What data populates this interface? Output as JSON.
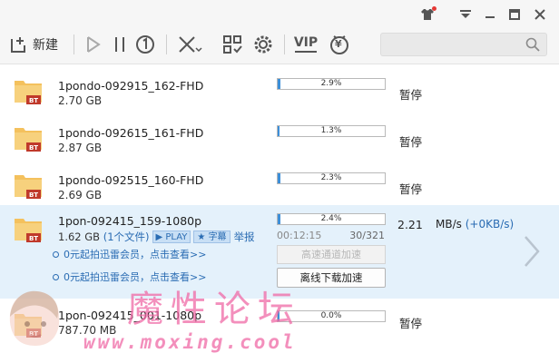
{
  "toolbar": {
    "new_label": "新建",
    "vip_label": "VIP",
    "yen_label": "¥",
    "search_placeholder": ""
  },
  "downloads": [
    {
      "name": "1pondo-092915_162-FHD",
      "size": "2.70 GB",
      "progress": "2.9%",
      "progress_value": 0.029,
      "status": "暂停"
    },
    {
      "name": "1pondo-092615_161-FHD",
      "size": "2.87 GB",
      "progress": "1.3%",
      "progress_value": 0.013,
      "status": "暂停"
    },
    {
      "name": "1pondo-092515_160-FHD",
      "size": "2.69 GB",
      "progress": "2.3%",
      "progress_value": 0.023,
      "status": "暂停"
    },
    {
      "name": "1pon-092415_159-1080p",
      "size": "1.62 GB",
      "file_count": "(1个文件)",
      "play_label": "PLAY",
      "subtitle_label": "字幕",
      "report_label": "举报",
      "progress": "2.4%",
      "progress_value": 0.024,
      "time_left": "00:12:15",
      "counts": "30/321",
      "speed": "2.21",
      "speed_unit": "MB/s",
      "upload_speed": "(+0KB/s)",
      "vip_line_1": "0元起拍迅雷会员，点击查看>>",
      "vip_line_2": "0元起拍迅雷会员，点击查看>>",
      "accel_button": "高速通道加速",
      "offline_button": "离线下载加速"
    },
    {
      "name": "1pon-092415_001-1080p",
      "size": "787.70 MB",
      "progress": "0.0%",
      "progress_value": 0.0,
      "status": "暂停"
    }
  ],
  "watermark": {
    "title": "魔性论坛",
    "url": "www.moxing.cool"
  },
  "colors": {
    "accent": "#3c8fd9",
    "selected_row": "#e4f1fb",
    "link": "#2a6cb3",
    "watermark": "#f06aa6",
    "bt_badge": "#c0392b"
  }
}
